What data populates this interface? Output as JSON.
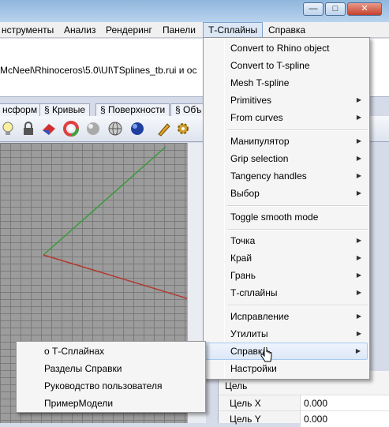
{
  "window": {
    "controls": [
      "—",
      "□",
      "✕"
    ]
  },
  "menubar": {
    "items": [
      "нструменты",
      "Анализ",
      "Рендеринг",
      "Панели",
      "Т-Сплайны",
      "Справка"
    ]
  },
  "command": {
    "text": "McNeel\\Rhinoceros\\5.0\\UI\\TSplines_tb.rui и ос"
  },
  "toolbar_tabs": [
    "нсформ",
    "§ Кривые",
    "§ Поверхности",
    "§ Объ"
  ],
  "toolbar_icons": [
    "lightbulb-icon",
    "lock-icon",
    "render-icon",
    "color-wheel-icon",
    "sphere-icon",
    "wireframe-sphere-icon",
    "blue-sphere-icon",
    "pen-icon",
    "gear-icon"
  ],
  "dropdown": {
    "items": [
      {
        "label": "Convert to Rhino object",
        "submenu": false
      },
      {
        "label": "Convert to T-spline",
        "submenu": false
      },
      {
        "label": "Mesh T-spline",
        "submenu": false
      },
      {
        "label": "Primitives",
        "submenu": true
      },
      {
        "label": "From curves",
        "submenu": true
      },
      {
        "label": "Манипулятор",
        "submenu": true
      },
      {
        "label": "Grip selection",
        "submenu": true
      },
      {
        "label": "Tangency handles",
        "submenu": true
      },
      {
        "label": "Выбор",
        "submenu": true
      },
      {
        "label": "Toggle smooth mode",
        "submenu": false
      },
      {
        "label": "Точка",
        "submenu": true
      },
      {
        "label": "Край",
        "submenu": true
      },
      {
        "label": "Грань",
        "submenu": true
      },
      {
        "label": "Т-сплайны",
        "submenu": true
      },
      {
        "label": "Исправление",
        "submenu": true
      },
      {
        "label": "Утилиты",
        "submenu": true
      },
      {
        "label": "Справка",
        "submenu": true,
        "highlighted": true
      },
      {
        "label": "Настройки",
        "submenu": false
      }
    ]
  },
  "submenu": {
    "items": [
      "о Т-Сплайнах",
      "Разделы Справки",
      "Руководство пользователя",
      "ПримерМодели"
    ]
  },
  "properties": {
    "section": "Цель",
    "rows": [
      {
        "label": "Цель X",
        "value": "0.000"
      },
      {
        "label": "Цель Y",
        "value": "0.000"
      }
    ]
  },
  "colors": {
    "x_axis": "#b03a2e",
    "y_axis": "#3a9a3a",
    "highlight": "#dce8f8"
  }
}
